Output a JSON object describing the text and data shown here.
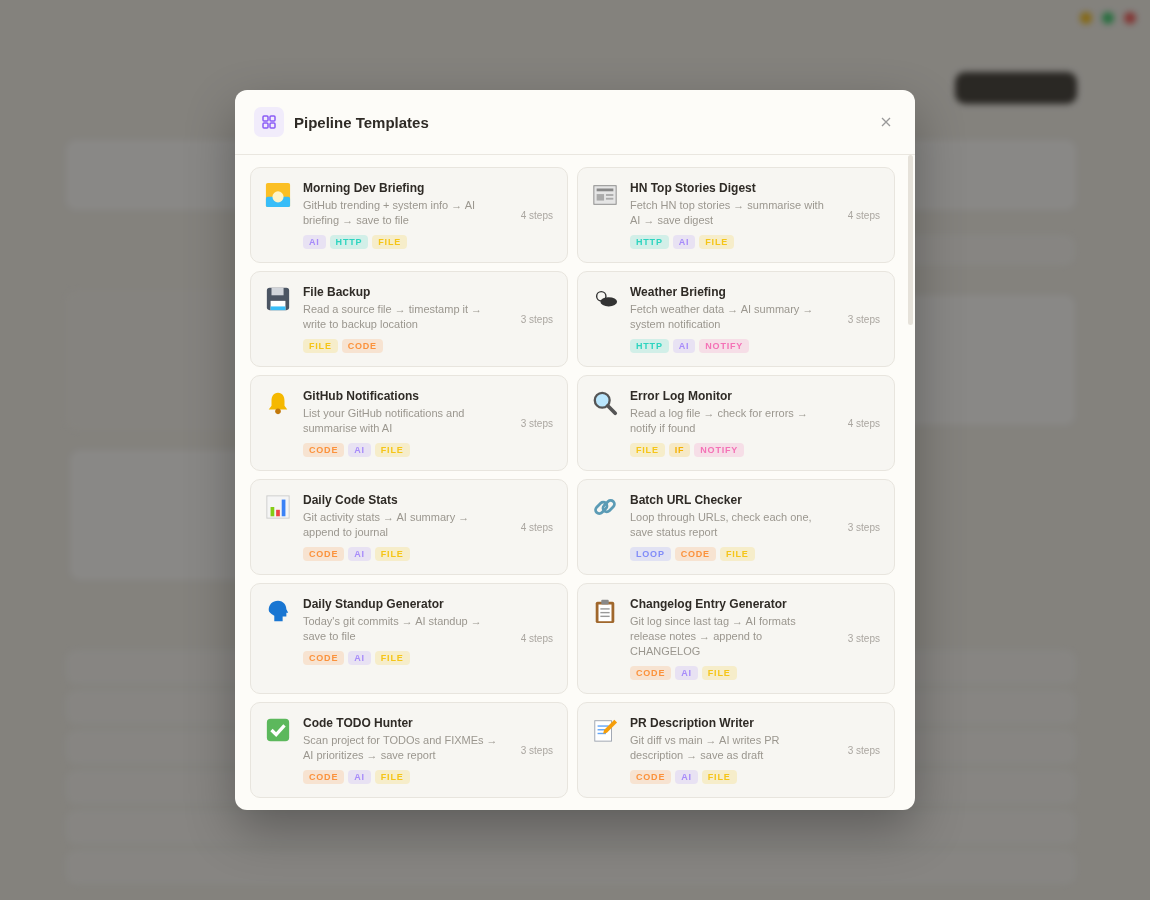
{
  "dialog": {
    "title": "Pipeline Templates"
  },
  "templates": [
    {
      "title": "Morning Dev Briefing",
      "description": "GitHub trending + system info → AI briefing → save to file",
      "steps": "4 steps",
      "tags": [
        {
          "label": "AI",
          "color": "#a78bfa"
        },
        {
          "label": "HTTP",
          "color": "#2dd4bf"
        },
        {
          "label": "FILE",
          "color": "#f5c518"
        }
      ]
    },
    {
      "title": "HN Top Stories Digest",
      "description": "Fetch HN top stories → summarise with AI → save digest",
      "steps": "4 steps",
      "tags": [
        {
          "label": "HTTP",
          "color": "#2dd4bf"
        },
        {
          "label": "AI",
          "color": "#a78bfa"
        },
        {
          "label": "FILE",
          "color": "#f5c518"
        }
      ]
    },
    {
      "title": "File Backup",
      "description": "Read a source file → timestamp it → write to backup location",
      "steps": "3 steps",
      "tags": [
        {
          "label": "FILE",
          "color": "#f5c518"
        },
        {
          "label": "CODE",
          "color": "#fb923c"
        }
      ]
    },
    {
      "title": "Weather Briefing",
      "description": "Fetch weather data → AI summary → system notification",
      "steps": "3 steps",
      "tags": [
        {
          "label": "HTTP",
          "color": "#2dd4bf"
        },
        {
          "label": "AI",
          "color": "#a78bfa"
        },
        {
          "label": "NOTIFY",
          "color": "#f472b6"
        }
      ]
    },
    {
      "title": "GitHub Notifications",
      "description": "List your GitHub notifications and summarise with AI",
      "steps": "3 steps",
      "tags": [
        {
          "label": "CODE",
          "color": "#fb923c"
        },
        {
          "label": "AI",
          "color": "#a78bfa"
        },
        {
          "label": "FILE",
          "color": "#f5c518"
        }
      ]
    },
    {
      "title": "Error Log Monitor",
      "description": "Read a log file → check for errors → notify if found",
      "steps": "4 steps",
      "tags": [
        {
          "label": "FILE",
          "color": "#f5c518"
        },
        {
          "label": "IF",
          "color": "#f5b000"
        },
        {
          "label": "NOTIFY",
          "color": "#f472b6"
        }
      ]
    },
    {
      "title": "Daily Code Stats",
      "description": "Git activity stats → AI summary → append to journal",
      "steps": "4 steps",
      "tags": [
        {
          "label": "CODE",
          "color": "#fb923c"
        },
        {
          "label": "AI",
          "color": "#a78bfa"
        },
        {
          "label": "FILE",
          "color": "#f5c518"
        }
      ]
    },
    {
      "title": "Batch URL Checker",
      "description": "Loop through URLs, check each one, save status report",
      "steps": "3 steps",
      "tags": [
        {
          "label": "LOOP",
          "color": "#818cf8"
        },
        {
          "label": "CODE",
          "color": "#fb923c"
        },
        {
          "label": "FILE",
          "color": "#f5c518"
        }
      ]
    },
    {
      "title": "Daily Standup Generator",
      "description": "Today's git commits → AI standup → save to file",
      "steps": "4 steps",
      "tags": [
        {
          "label": "CODE",
          "color": "#fb923c"
        },
        {
          "label": "AI",
          "color": "#a78bfa"
        },
        {
          "label": "FILE",
          "color": "#f5c518"
        }
      ]
    },
    {
      "title": "Changelog Entry Generator",
      "description": "Git log since last tag → AI formats release notes → append to CHANGELOG",
      "steps": "3 steps",
      "tags": [
        {
          "label": "CODE",
          "color": "#fb923c"
        },
        {
          "label": "AI",
          "color": "#a78bfa"
        },
        {
          "label": "FILE",
          "color": "#f5c518"
        }
      ]
    },
    {
      "title": "Code TODO Hunter",
      "description": "Scan project for TODOs and FIXMEs → AI prioritizes → save report",
      "steps": "3 steps",
      "tags": [
        {
          "label": "CODE",
          "color": "#fb923c"
        },
        {
          "label": "AI",
          "color": "#a78bfa"
        },
        {
          "label": "FILE",
          "color": "#f5c518"
        }
      ]
    },
    {
      "title": "PR Description Writer",
      "description": "Git diff vs main → AI writes PR description → save as draft",
      "steps": "3 steps",
      "tags": [
        {
          "label": "CODE",
          "color": "#fb923c"
        },
        {
          "label": "AI",
          "color": "#a78bfa"
        },
        {
          "label": "FILE",
          "color": "#f5c518"
        }
      ]
    }
  ]
}
